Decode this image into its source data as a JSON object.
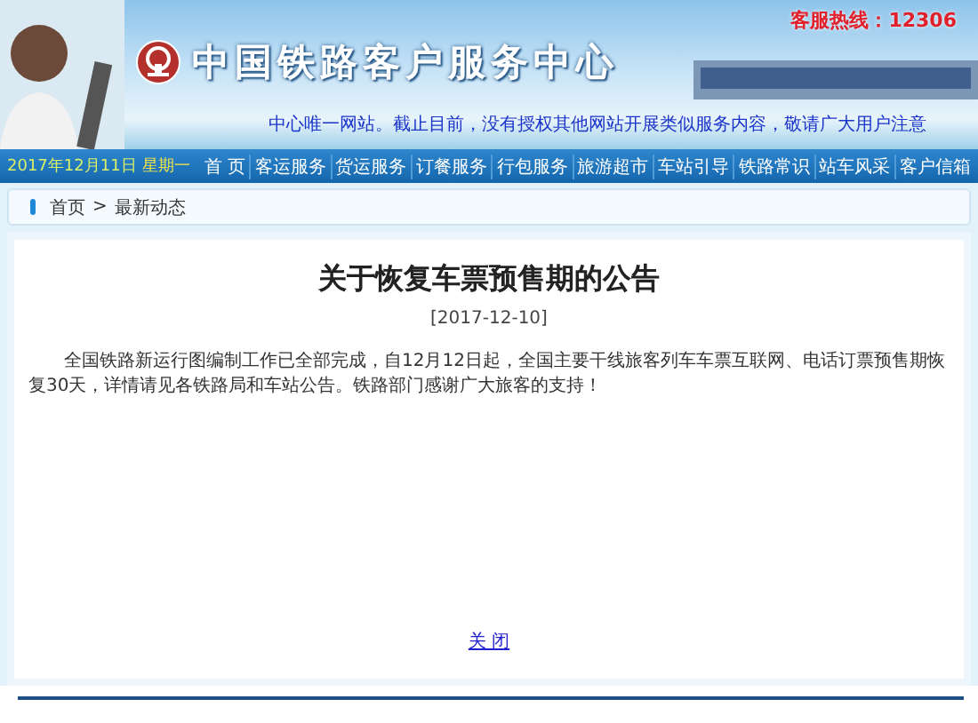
{
  "banner": {
    "title": "中国铁路客户服务中心",
    "hotline": "客服热线：12306",
    "notice": "中心唯一网站。截止目前，没有授权其他网站开展类似服务内容，敬请广大用户注意"
  },
  "nav": {
    "date": "2017年12月11日",
    "weekday": "星期一",
    "items": [
      {
        "label": "首 页"
      },
      {
        "label": "客运服务"
      },
      {
        "label": "货运服务"
      },
      {
        "label": "订餐服务"
      },
      {
        "label": "行包服务"
      },
      {
        "label": "旅游超市"
      },
      {
        "label": "车站引导"
      },
      {
        "label": "铁路常识"
      },
      {
        "label": "站车风采"
      },
      {
        "label": "客户信箱"
      }
    ]
  },
  "breadcrumb": {
    "separator": ">",
    "items": [
      {
        "label": "首页"
      },
      {
        "label": "最新动态"
      }
    ]
  },
  "article": {
    "title": "关于恢复车票预售期的公告",
    "date": "[2017-12-10]",
    "body": "全国铁路新运行图编制工作已全部完成，自12月12日起，全国主要干线旅客列车车票互联网、电话订票预售期恢复30天，详情请见各铁路局和车站公告。铁路部门感谢广大旅客的支持！",
    "close": "关 闭"
  }
}
